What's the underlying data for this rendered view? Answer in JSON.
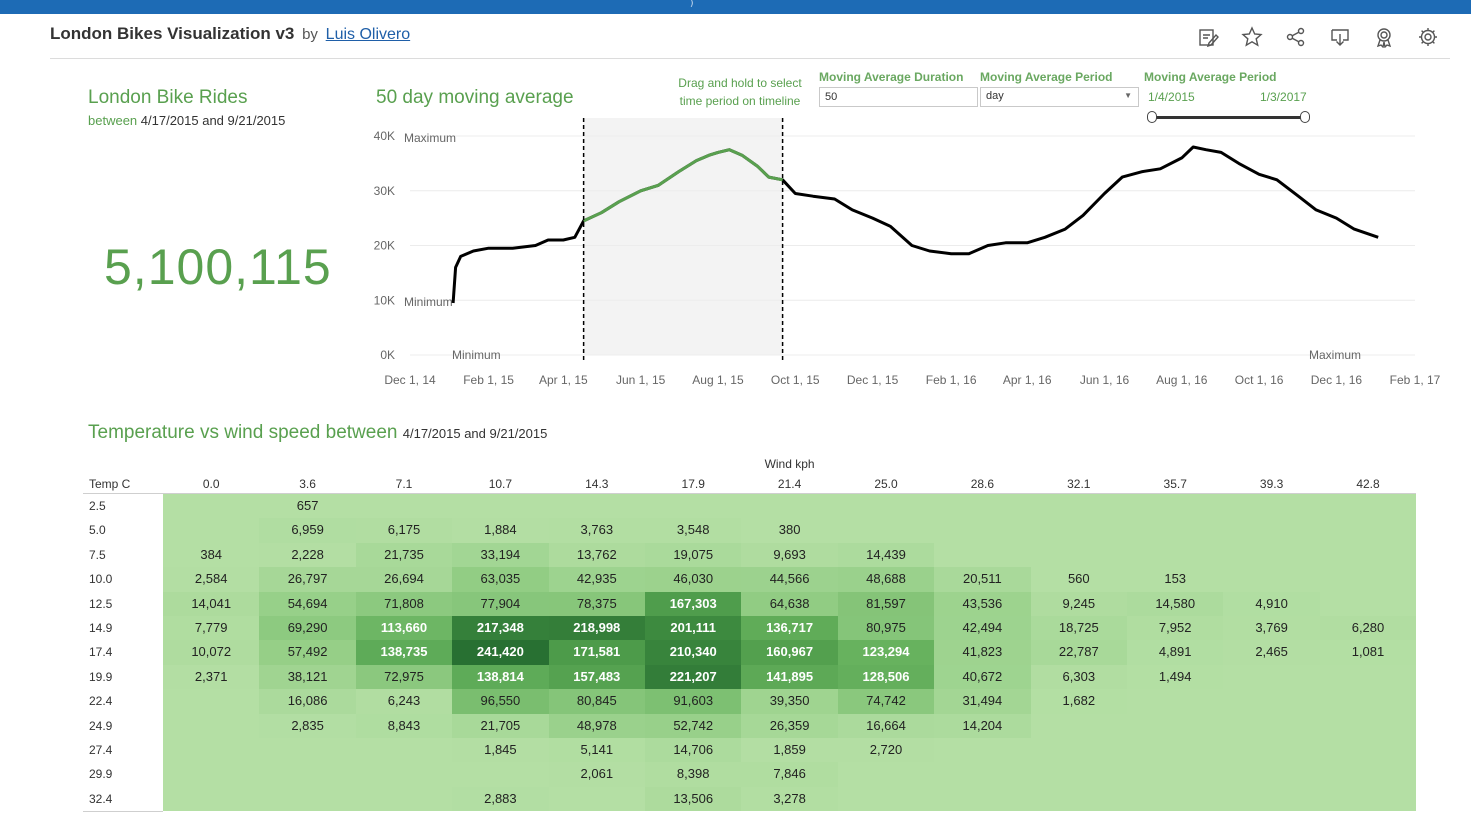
{
  "header": {
    "title": "London Bikes Visualization v3",
    "by": "by",
    "author": "Luis Olivero",
    "tools": [
      "edit-icon",
      "star-icon",
      "share-icon",
      "download-icon",
      "badge-icon",
      "settings-icon"
    ]
  },
  "kpi": {
    "title": "London Bike Rides",
    "between_label": "between",
    "date_range": "4/17/2015 and 9/21/2015",
    "value": "5,100,115"
  },
  "controls": {
    "drag_hint": "Drag and hold to select time period on timeline",
    "ma_duration_label": "Moving Average Duration",
    "ma_duration_value": "50",
    "ma_period_label": "Moving Average Period",
    "ma_period_value": "day",
    "range_label": "Moving Average Period",
    "range_start": "1/4/2015",
    "range_end": "1/3/2017"
  },
  "colors": {
    "accent": "#59a04f",
    "line": "#000000",
    "header_bar": "#1d6bb5"
  },
  "chart_data": [
    {
      "type": "line",
      "title": "50 day moving average",
      "xlabel": "",
      "ylabel": "",
      "x_ticks": [
        "Dec 1, 14",
        "Feb 1, 15",
        "Apr 1, 15",
        "Jun 1, 15",
        "Aug 1, 15",
        "Oct 1, 15",
        "Dec 1, 15",
        "Feb 1, 16",
        "Apr 1, 16",
        "Jun 1, 16",
        "Aug 1, 16",
        "Oct 1, 16",
        "Dec 1, 16",
        "Feb 1, 17"
      ],
      "y_ticks": [
        "0K",
        "10K",
        "20K",
        "30K",
        "40K"
      ],
      "ylim": [
        0,
        40000
      ],
      "xlim": [
        "2014-12-01",
        "2017-02-01"
      ],
      "annotations": {
        "max_label": "Maximum",
        "min_label": "Minimum"
      },
      "selection": {
        "start": "2015-04-17",
        "end": "2015-09-21"
      },
      "series": [
        {
          "x": [
            "2015-01-04",
            "2015-01-06",
            "2015-01-10",
            "2015-01-20",
            "2015-02-01",
            "2015-02-20",
            "2015-03-10",
            "2015-03-20",
            "2015-04-01",
            "2015-04-10",
            "2015-04-17",
            "2015-05-01",
            "2015-05-15",
            "2015-06-01",
            "2015-06-15",
            "2015-07-01",
            "2015-07-15",
            "2015-07-25",
            "2015-08-01",
            "2015-08-10",
            "2015-08-20",
            "2015-09-01",
            "2015-09-10",
            "2015-09-21",
            "2015-10-01",
            "2015-10-15",
            "2015-11-01",
            "2015-11-15",
            "2015-12-01",
            "2015-12-15",
            "2016-01-01",
            "2016-01-15",
            "2016-02-01",
            "2016-02-15",
            "2016-03-01",
            "2016-03-15",
            "2016-04-01",
            "2016-04-15",
            "2016-05-01",
            "2016-05-15",
            "2016-06-01",
            "2016-06-15",
            "2016-07-01",
            "2016-07-15",
            "2016-08-01",
            "2016-08-10",
            "2016-08-20",
            "2016-09-01",
            "2016-09-15",
            "2016-10-01",
            "2016-10-15",
            "2016-11-01",
            "2016-11-15",
            "2016-12-01",
            "2016-12-15",
            "2017-01-03"
          ],
          "y": [
            9500,
            16000,
            18000,
            19000,
            19500,
            19500,
            20000,
            21000,
            21000,
            21500,
            24500,
            26000,
            28000,
            30000,
            31000,
            33500,
            35500,
            36500,
            37000,
            37500,
            36500,
            34500,
            32500,
            32000,
            29500,
            29000,
            28500,
            26500,
            25000,
            23500,
            20000,
            19000,
            18500,
            18500,
            20000,
            20500,
            20500,
            21500,
            23000,
            25500,
            29500,
            32500,
            33500,
            34000,
            36000,
            38000,
            37500,
            37000,
            35000,
            33000,
            32000,
            29000,
            26500,
            25000,
            23000,
            21500
          ]
        }
      ]
    },
    {
      "type": "heatmap",
      "title": "Temperature vs wind speed between",
      "dates": "4/17/2015 and 9/21/2015",
      "xlabel": "Wind kph",
      "ylabel": "Temp C",
      "columns": [
        "0.0",
        "3.6",
        "7.1",
        "10.7",
        "14.3",
        "17.9",
        "21.4",
        "25.0",
        "28.6",
        "32.1",
        "35.7",
        "39.3",
        "42.8"
      ],
      "rows": [
        "2.5",
        "5.0",
        "7.5",
        "10.0",
        "12.5",
        "14.9",
        "17.4",
        "19.9",
        "22.4",
        "24.9",
        "27.4",
        "29.9",
        "32.4"
      ],
      "values": [
        [
          null,
          657,
          null,
          null,
          null,
          null,
          null,
          null,
          null,
          null,
          null,
          null,
          null
        ],
        [
          null,
          6959,
          6175,
          1884,
          3763,
          3548,
          380,
          null,
          null,
          null,
          null,
          null,
          null
        ],
        [
          384,
          2228,
          21735,
          33194,
          13762,
          19075,
          9693,
          14439,
          null,
          null,
          null,
          null,
          null
        ],
        [
          2584,
          26797,
          26694,
          63035,
          42935,
          46030,
          44566,
          48688,
          20511,
          560,
          153,
          null,
          null
        ],
        [
          14041,
          54694,
          71808,
          77904,
          78375,
          167303,
          64638,
          81597,
          43536,
          9245,
          14580,
          4910,
          null
        ],
        [
          7779,
          69290,
          113660,
          217348,
          218998,
          201111,
          136717,
          80975,
          42494,
          18725,
          7952,
          3769,
          6280
        ],
        [
          10072,
          57492,
          138735,
          241420,
          171581,
          210340,
          160967,
          123294,
          41823,
          22787,
          4891,
          2465,
          1081
        ],
        [
          2371,
          38121,
          72975,
          138814,
          157483,
          221207,
          141895,
          128506,
          40672,
          6303,
          1494,
          null,
          null
        ],
        [
          null,
          16086,
          6243,
          96550,
          80845,
          91603,
          39350,
          74742,
          31494,
          1682,
          null,
          null,
          null
        ],
        [
          null,
          2835,
          8843,
          21705,
          48978,
          52742,
          26359,
          16664,
          14204,
          null,
          null,
          null,
          null
        ],
        [
          null,
          null,
          null,
          1845,
          5141,
          14706,
          1859,
          2720,
          null,
          null,
          null,
          null,
          null
        ],
        [
          null,
          null,
          null,
          null,
          2061,
          8398,
          7846,
          null,
          null,
          null,
          null,
          null,
          null
        ],
        [
          null,
          null,
          null,
          2883,
          null,
          13506,
          3278,
          null,
          null,
          null,
          null,
          null,
          null
        ]
      ]
    }
  ]
}
